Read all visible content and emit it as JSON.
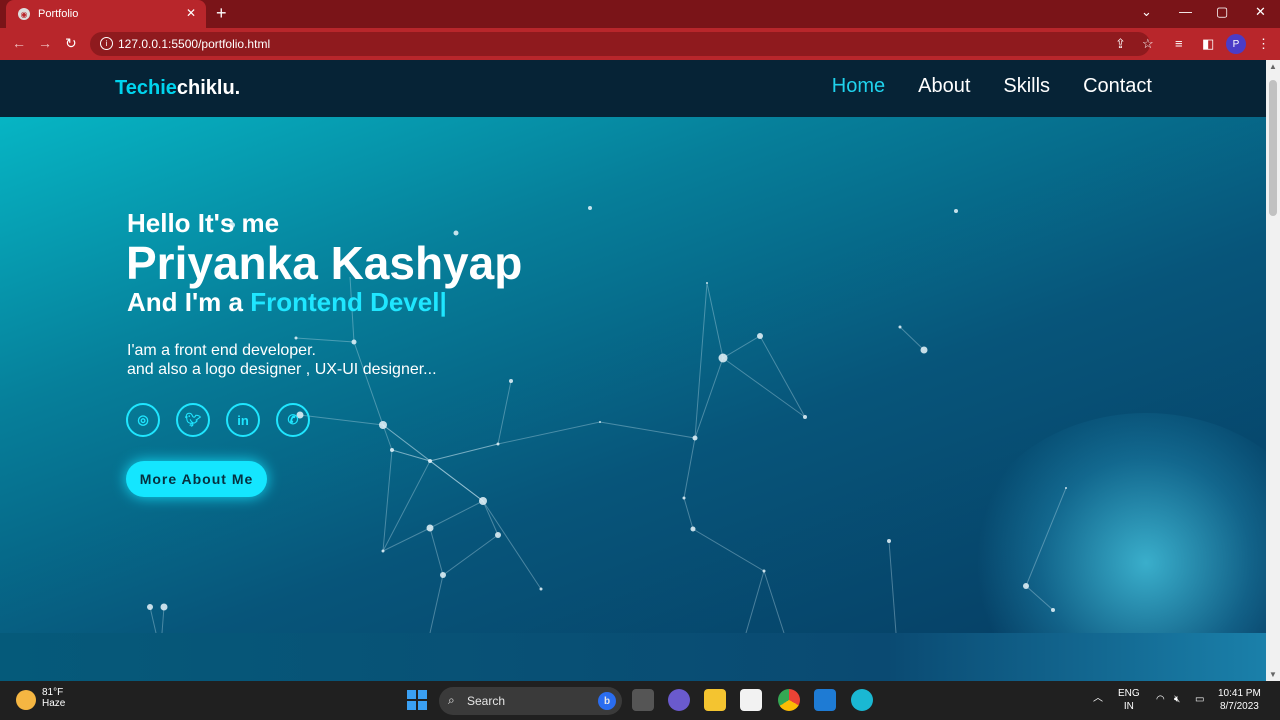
{
  "browser": {
    "tab_title": "Portfolio",
    "tab_close": "✕",
    "new_tab": "+",
    "url": "127.0.0.1:5500/portfolio.html",
    "profile_initial": "P"
  },
  "site": {
    "logo_accent": "Techie",
    "logo_rest": "chiklu.",
    "nav": [
      "Home",
      "About",
      "Skills",
      "Contact"
    ],
    "hero": {
      "hello": "Hello It's me",
      "name": "Priyanka Kashyap",
      "role_prefix": "And I'm a ",
      "role_typed": "Frontend Devel|",
      "desc_line1": "I'am a front end developer.",
      "desc_line2": "and also a logo designer , UX-UI designer...",
      "social_icons": [
        "instagram-icon",
        "twitter-icon",
        "linkedin-icon",
        "whatsapp-icon"
      ],
      "cta": "More About Me"
    }
  },
  "taskbar": {
    "temp": "81°F",
    "weather": "Haze",
    "search": "Search",
    "lang1": "ENG",
    "lang2": "IN",
    "time": "10:41 PM",
    "date": "8/7/2023"
  },
  "colors": {
    "accent": "#1fd2ec",
    "browser_red": "#b8262b",
    "header_bg": "#062336"
  }
}
